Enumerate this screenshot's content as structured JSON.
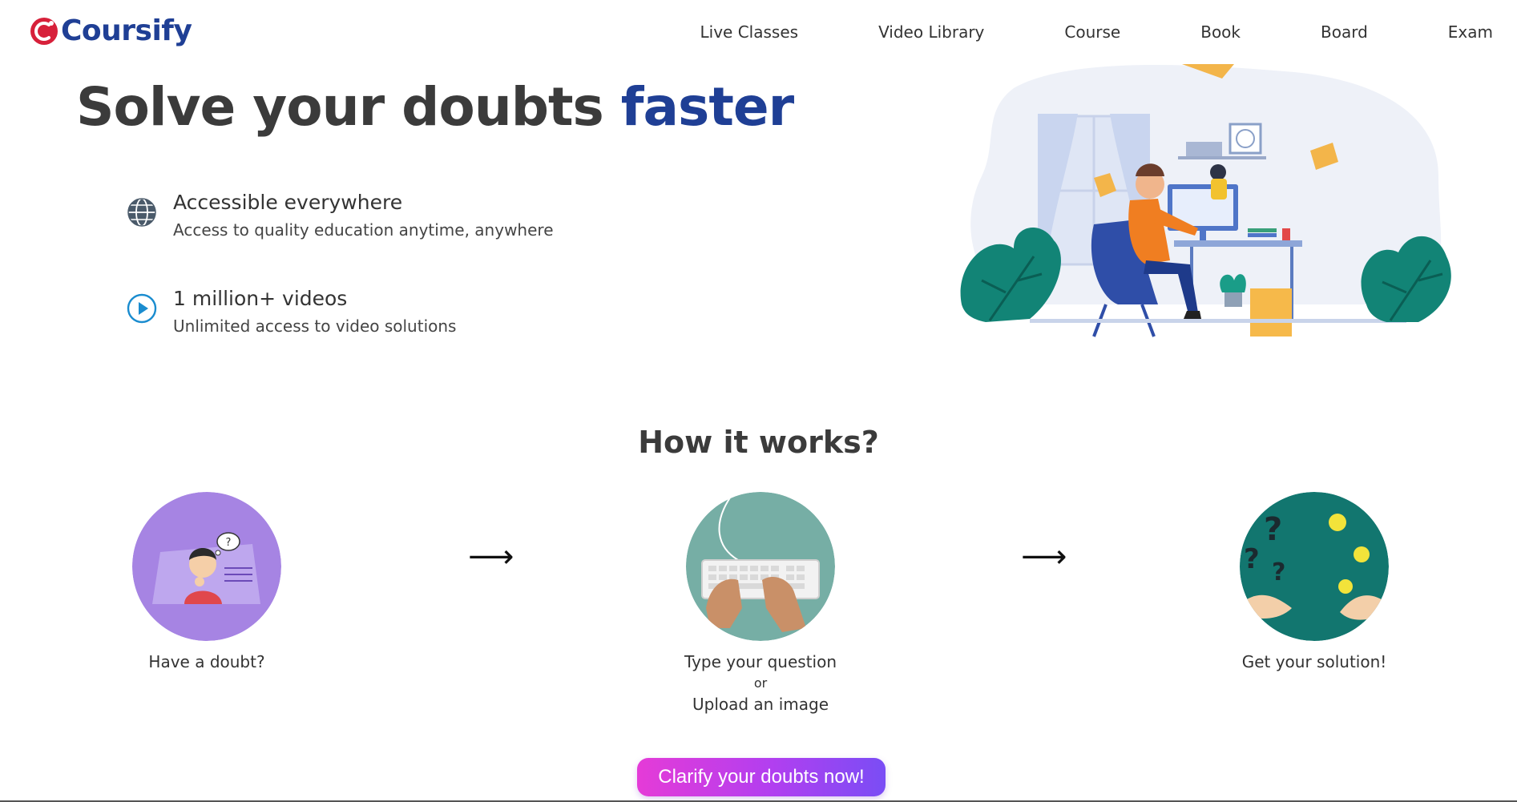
{
  "brand": {
    "name": "Coursify",
    "color": "#1f3f95",
    "mark_color": "#d7203a"
  },
  "nav": {
    "items": [
      {
        "label": "Live Classes"
      },
      {
        "label": "Video Library"
      },
      {
        "label": "Course"
      },
      {
        "label": "Book"
      },
      {
        "label": "Board"
      },
      {
        "label": "Exam"
      }
    ]
  },
  "hero": {
    "title_main": "Solve your doubts ",
    "title_accent": "faster",
    "features": [
      {
        "icon": "globe-icon",
        "title": "Accessible everywhere",
        "subtitle": "Access to quality education anytime, anywhere"
      },
      {
        "icon": "play-circle-icon",
        "title": "1 million+ videos",
        "subtitle": "Unlimited access to video solutions"
      }
    ]
  },
  "how": {
    "title": "How it works?",
    "steps": [
      {
        "label": "Have a doubt?",
        "bg": "#a684e3"
      },
      {
        "label": "Type your question",
        "or": "or",
        "label2": "Upload an image",
        "bg": "#76aea5"
      },
      {
        "label": "Get your solution!",
        "bg": "#12766f"
      }
    ],
    "arrow": "⟶"
  },
  "cta": {
    "label": "Clarify your doubts now!"
  }
}
